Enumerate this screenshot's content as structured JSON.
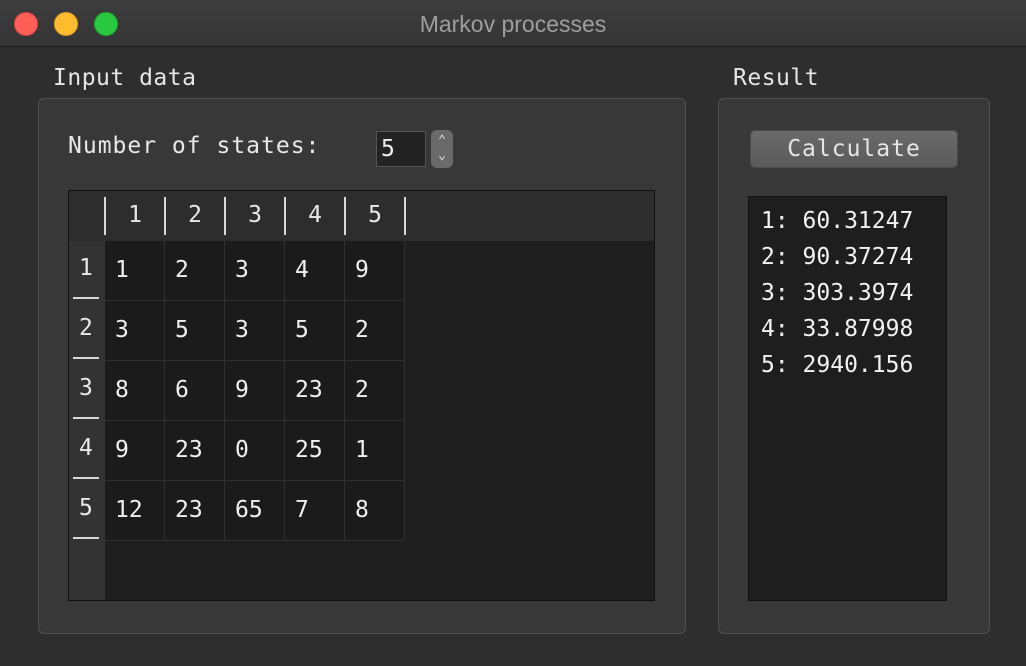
{
  "window": {
    "title": "Markov processes"
  },
  "input_group": {
    "label": "Input data",
    "states_label": "Number of states:",
    "states_value": "5"
  },
  "table": {
    "columns": [
      "1",
      "2",
      "3",
      "4",
      "5"
    ],
    "rows": [
      {
        "header": "1",
        "cells": [
          "1",
          "2",
          "3",
          "4",
          "9"
        ]
      },
      {
        "header": "2",
        "cells": [
          "3",
          "5",
          "3",
          "5",
          "2"
        ]
      },
      {
        "header": "3",
        "cells": [
          "8",
          "6",
          "9",
          "23",
          "2"
        ]
      },
      {
        "header": "4",
        "cells": [
          "9",
          "23",
          "0",
          "25",
          "1"
        ]
      },
      {
        "header": "5",
        "cells": [
          "12",
          "23",
          "65",
          "7",
          "8"
        ]
      }
    ]
  },
  "result_group": {
    "label": "Result",
    "calculate_label": "Calculate",
    "results": [
      "1: 60.31247",
      "2: 90.37274",
      "3: 303.3974",
      "4: 33.87998",
      "5: 2940.156"
    ]
  }
}
